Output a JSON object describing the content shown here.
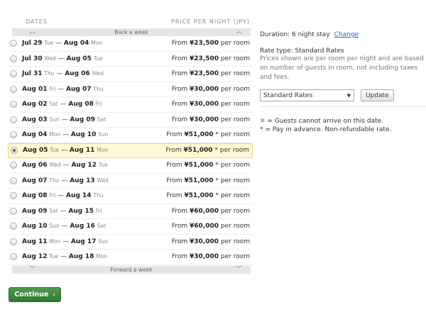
{
  "columns": {
    "dates": "DATES",
    "price": "PRICE PER NIGHT (JPY)"
  },
  "nav": {
    "back": "Back a week",
    "forward": "Forward a week"
  },
  "rows": [
    {
      "start": "Jul 29",
      "start_dow": "Tue",
      "end": "Aug 04",
      "end_dow": "Mon",
      "from": "From",
      "price": "¥23,500",
      "star": "",
      "unit": "per room",
      "selected": false
    },
    {
      "start": "Jul 30",
      "start_dow": "Wed",
      "end": "Aug 05",
      "end_dow": "Tue",
      "from": "From",
      "price": "¥23,500",
      "star": "",
      "unit": "per room",
      "selected": false
    },
    {
      "start": "Jul 31",
      "start_dow": "Thu",
      "end": "Aug 06",
      "end_dow": "Wed",
      "from": "From",
      "price": "¥23,500",
      "star": "",
      "unit": "per room",
      "selected": false
    },
    {
      "start": "Aug 01",
      "start_dow": "Fri",
      "end": "Aug 07",
      "end_dow": "Thu",
      "from": "From",
      "price": "¥30,000",
      "star": "",
      "unit": "per room",
      "selected": false
    },
    {
      "start": "Aug 02",
      "start_dow": "Sat",
      "end": "Aug 08",
      "end_dow": "Fri",
      "from": "From",
      "price": "¥30,000",
      "star": "",
      "unit": "per room",
      "selected": false
    },
    {
      "start": "Aug 03",
      "start_dow": "Sun",
      "end": "Aug 09",
      "end_dow": "Sat",
      "from": "From",
      "price": "¥30,000",
      "star": "",
      "unit": "per room",
      "selected": false
    },
    {
      "start": "Aug 04",
      "start_dow": "Mon",
      "end": "Aug 10",
      "end_dow": "Sun",
      "from": "From",
      "price": "¥51,000",
      "star": "*",
      "unit": "per room",
      "selected": false
    },
    {
      "start": "Aug 05",
      "start_dow": "Tue",
      "end": "Aug 11",
      "end_dow": "Mon",
      "from": "From",
      "price": "¥51,000",
      "star": "*",
      "unit": "per room",
      "selected": true
    },
    {
      "start": "Aug 06",
      "start_dow": "Wed",
      "end": "Aug 12",
      "end_dow": "Tue",
      "from": "From",
      "price": "¥51,000",
      "star": "*",
      "unit": "per room",
      "selected": false
    },
    {
      "start": "Aug 07",
      "start_dow": "Thu",
      "end": "Aug 13",
      "end_dow": "Wed",
      "from": "From",
      "price": "¥51,000",
      "star": "*",
      "unit": "per room",
      "selected": false
    },
    {
      "start": "Aug 08",
      "start_dow": "Fri",
      "end": "Aug 14",
      "end_dow": "Thu",
      "from": "From",
      "price": "¥51,000",
      "star": "*",
      "unit": "per room",
      "selected": false
    },
    {
      "start": "Aug 09",
      "start_dow": "Sat",
      "end": "Aug 15",
      "end_dow": "Fri",
      "from": "From",
      "price": "¥60,000",
      "star": "",
      "unit": "per room",
      "selected": false
    },
    {
      "start": "Aug 10",
      "start_dow": "Sun",
      "end": "Aug 16",
      "end_dow": "Sat",
      "from": "From",
      "price": "¥60,000",
      "star": "",
      "unit": "per room",
      "selected": false
    },
    {
      "start": "Aug 11",
      "start_dow": "Mon",
      "end": "Aug 17",
      "end_dow": "Sun",
      "from": "From",
      "price": "¥30,000",
      "star": "",
      "unit": "per room",
      "selected": false
    },
    {
      "start": "Aug 12",
      "start_dow": "Tue",
      "end": "Aug 18",
      "end_dow": "Mon",
      "from": "From",
      "price": "¥30,000",
      "star": "",
      "unit": "per room",
      "selected": false
    }
  ],
  "continue_label": "Continue",
  "side": {
    "duration": "Duration: 6 night stay",
    "change_link": "Change",
    "rate_type": "Rate type: Standard Rates",
    "description": "Prices shown are per room per night and are based on number of guests in room, not including taxes and fees.",
    "select_value": "Standard Rates",
    "update_label": "Update",
    "legend_x": "= Guests cannot arrive on this date.",
    "legend_star": "* = Pay in advance. Non-refundable rate."
  },
  "icons": {
    "back": "chevron-up-icon",
    "forward": "chevron-down-icon",
    "continue": "chevron-right-icon",
    "select": "caret-down-icon",
    "unavailable": "x-mark-icon"
  },
  "colors": {
    "continue_bg": "#3a8a3d",
    "selected_row": "#fff8d6",
    "link": "#2a63b8"
  }
}
